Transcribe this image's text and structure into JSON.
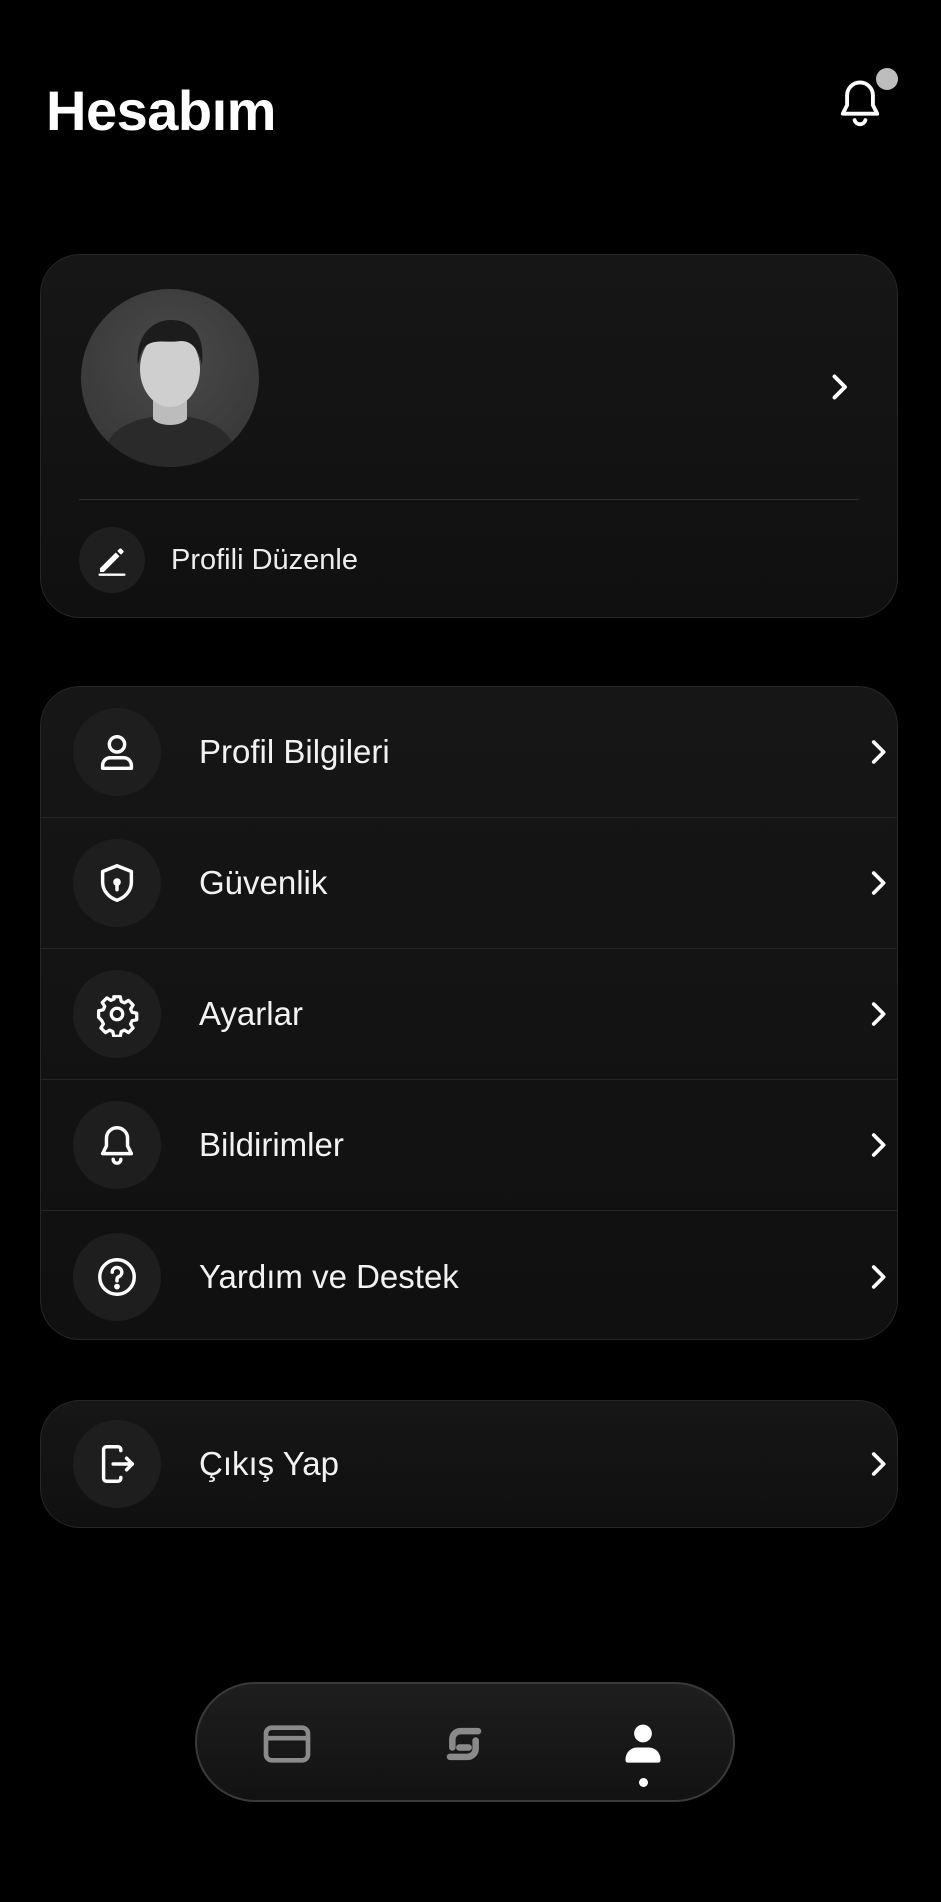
{
  "header": {
    "title": "Hesabım",
    "notification_icon": "bell-icon",
    "has_unread_dot": true
  },
  "profile_card": {
    "avatar_icon": "user-avatar",
    "chevron_icon": "chevron-right-icon",
    "edit_icon": "pencil-icon",
    "edit_label": "Profili Düzenle"
  },
  "menu": {
    "items": [
      {
        "label": "Profil Bilgileri",
        "icon": "user-icon"
      },
      {
        "label": "Güvenlik",
        "icon": "shield-icon"
      },
      {
        "label": "Ayarlar",
        "icon": "gear-icon"
      },
      {
        "label": "Bildirimler",
        "icon": "bell-icon"
      },
      {
        "label": "Yardım ve Destek",
        "icon": "help-circle-icon"
      }
    ]
  },
  "logout": {
    "label": "Çıkış Yap",
    "icon": "logout-icon"
  },
  "bottom_nav": {
    "items": [
      {
        "icon": "card-icon",
        "active": false
      },
      {
        "icon": "transfer-icon",
        "active": false
      },
      {
        "icon": "profile-icon",
        "active": true
      }
    ]
  },
  "colors": {
    "background": "#000000",
    "card": "#141414",
    "text": "#ffffff",
    "muted_icon": "#8a8a8a"
  }
}
